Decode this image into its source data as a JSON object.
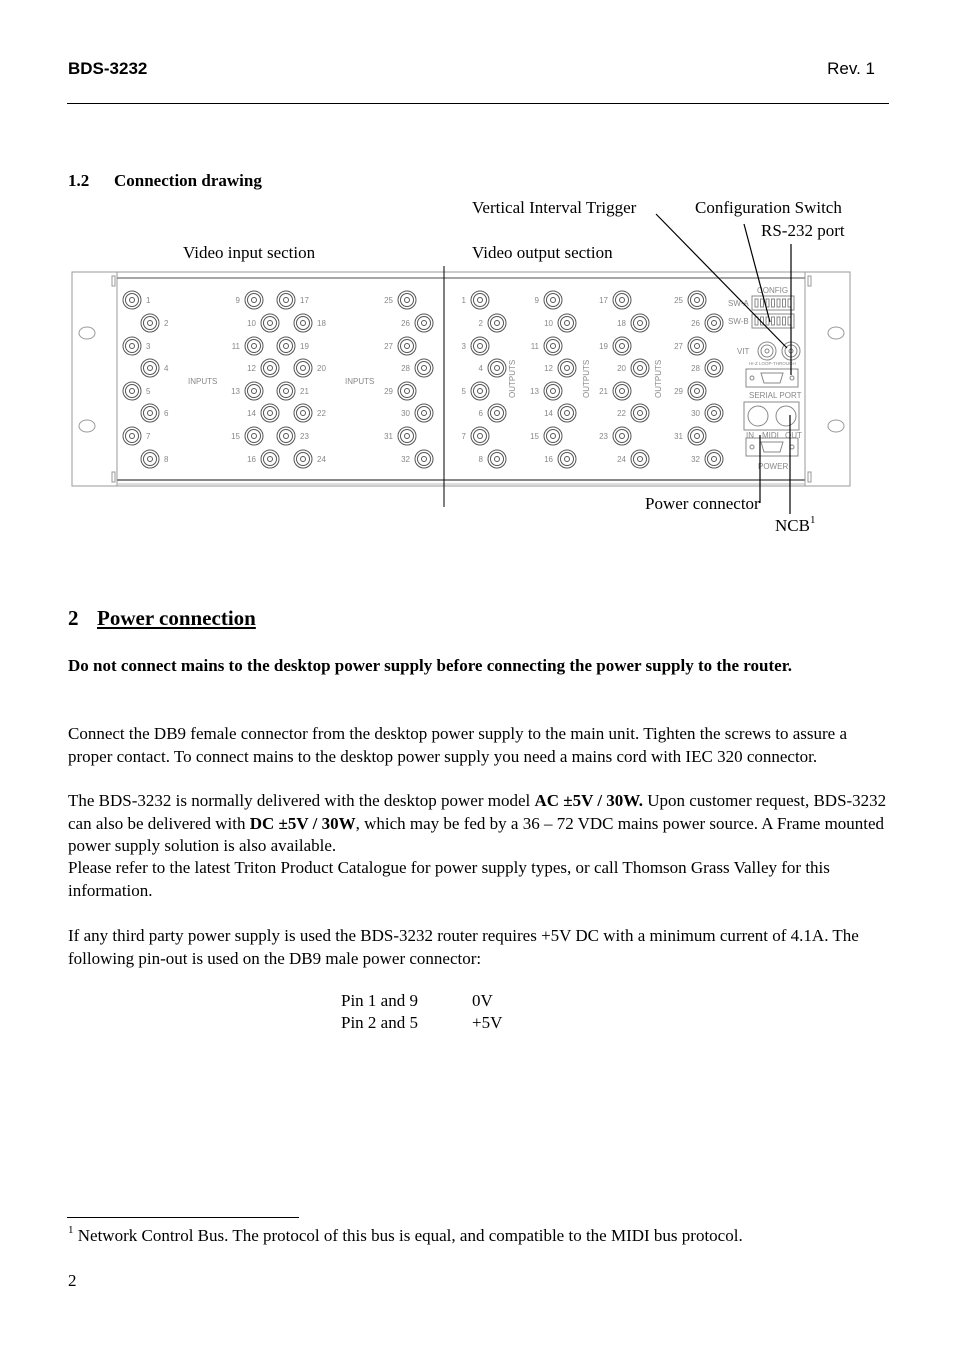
{
  "header": {
    "doc_id": "BDS-3232",
    "revision": "Rev. 1"
  },
  "section_1_2": {
    "number": "1.2",
    "title": "Connection drawing"
  },
  "drawing": {
    "callouts": {
      "vit": "Vertical Interval Trigger",
      "config_switch": "Configuration Switch",
      "rs232": "RS-232 port",
      "video_input": "Video input section",
      "video_output": "Video output section",
      "power_connector": "Power connector",
      "ncb": "NCB",
      "ncb_footnote_ref": "1"
    },
    "panel_labels": {
      "inputs": "INPUTS",
      "outputs": "OUTPUTS",
      "config": "CONFIG",
      "sw_a": "SW-A",
      "sw_b": "SW-B",
      "vit": "VIT",
      "loop_through": "HI-Z LOOP-THROUGH",
      "serial_port": "SERIAL PORT",
      "midi_in": "IN",
      "midi": "MIDI",
      "midi_out": "OUT",
      "power": "POWER"
    },
    "input_connectors": [
      "1",
      "2",
      "3",
      "4",
      "5",
      "6",
      "7",
      "8",
      "9",
      "10",
      "11",
      "12",
      "13",
      "14",
      "15",
      "16",
      "17",
      "18",
      "19",
      "20",
      "21",
      "22",
      "23",
      "24",
      "25",
      "26",
      "27",
      "28",
      "29",
      "30",
      "31",
      "32"
    ],
    "output_connectors": [
      "1",
      "2",
      "3",
      "4",
      "5",
      "6",
      "7",
      "8",
      "9",
      "10",
      "11",
      "12",
      "13",
      "14",
      "15",
      "16",
      "17",
      "18",
      "19",
      "20",
      "21",
      "22",
      "23",
      "24",
      "25",
      "26",
      "27",
      "28",
      "29",
      "30",
      "31",
      "32"
    ]
  },
  "section_2": {
    "number": "2",
    "title": "Power connection",
    "warning": "Do not connect mains to the desktop power supply before connecting the power supply to the router.",
    "p1": "Connect the DB9 female connector from the desktop power supply to the main unit. Tighten the screws to assure a proper contact. To connect mains to the desktop power supply you need a mains cord with IEC 320 connector.",
    "p2_a": "The BDS-3232 is normally delivered with the desktop power model ",
    "p2_b": "AC ±5V / 30W.",
    "p2_c": " Upon customer request, BDS-3232 can also be delivered with ",
    "p2_d": "DC ±5V / 30W",
    "p2_e": ", which may be fed by a 36 – 72 VDC mains power source. A Frame mounted power supply solution is also available.",
    "p3": "Please refer to the latest Triton Product Catalogue for power supply types, or call Thomson Grass Valley for this information.",
    "p4": "If any third party power supply is used the BDS-3232 router requires +5V DC with a minimum current of 4.1A. The following pin-out is used on the DB9 male power connector:",
    "pinout": [
      {
        "pins": "Pin 1 and 9",
        "value": "0V"
      },
      {
        "pins": "Pin 2 and 5",
        "value": "+5V"
      }
    ]
  },
  "footnote": {
    "mark": "1",
    "text": " Network Control Bus. The protocol of this bus is equal, and compatible to the MIDI bus protocol."
  },
  "page_number": "2"
}
